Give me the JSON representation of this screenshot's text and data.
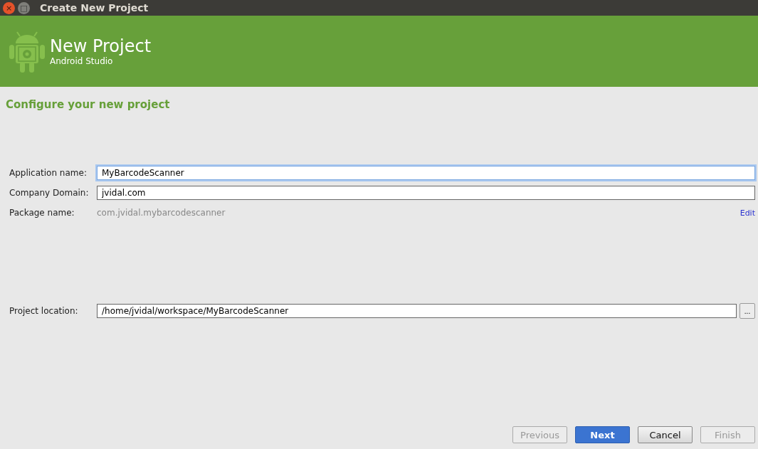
{
  "window": {
    "title": "Create New Project",
    "controls": [
      "×",
      "□"
    ]
  },
  "header": {
    "title": "New Project",
    "subtitle": "Android Studio"
  },
  "section_title": "Configure your new project",
  "fields": [
    {
      "label": "Application name:",
      "value": "MyBarcodeScanner",
      "focused": true
    },
    {
      "label": "Company Domain:",
      "value": "jvidal.com",
      "focused": false
    }
  ],
  "package": {
    "label": "Package name:",
    "value": "com.jvidal.mybarcodescanner",
    "edit_link": "Edit"
  },
  "location": {
    "label": "Project location:",
    "value": "/home/jvidal/workspace/MyBarcodeScanner",
    "browse": "..."
  },
  "buttons": [
    {
      "label": "Previous",
      "disabled": true,
      "kind": "normal"
    },
    {
      "label": "Next",
      "disabled": false,
      "kind": "primary"
    },
    {
      "label": "Cancel",
      "disabled": false,
      "kind": "normal"
    },
    {
      "label": "Finish",
      "disabled": true,
      "kind": "normal"
    }
  ]
}
